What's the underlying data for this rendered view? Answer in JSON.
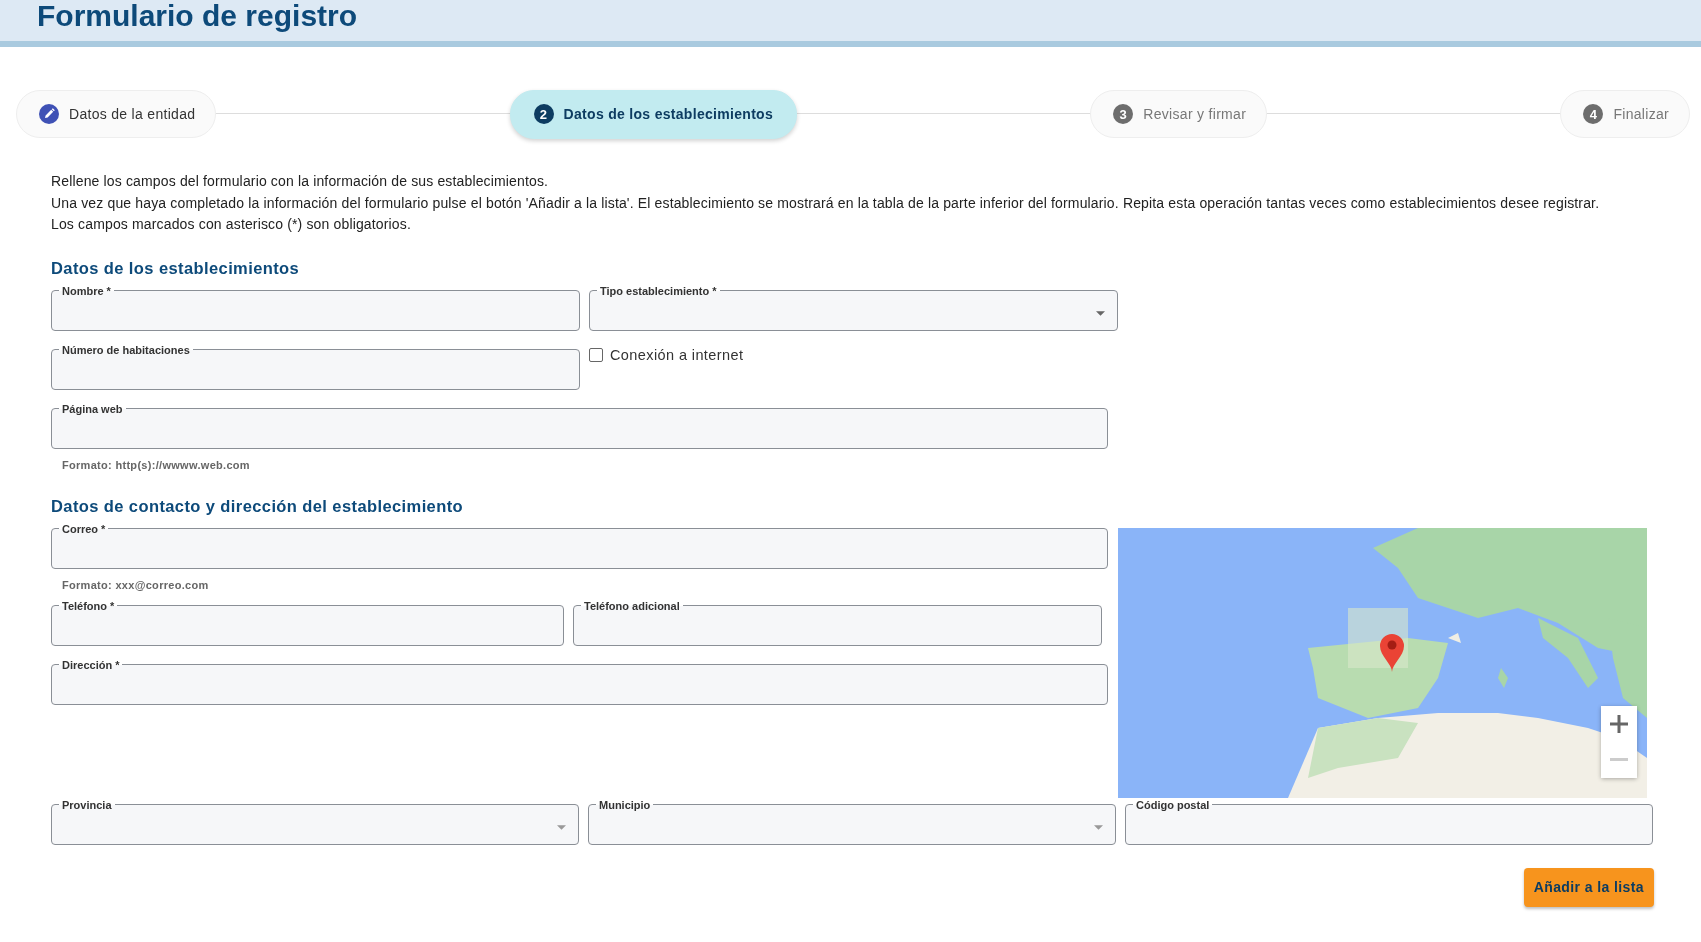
{
  "page": {
    "title": "Formulario de registro"
  },
  "steps": [
    {
      "label": "Datos de la entidad",
      "kind": "done",
      "selected": false
    },
    {
      "number": "2",
      "label": "Datos de los establecimientos",
      "kind": "current",
      "selected": true
    },
    {
      "number": "3",
      "label": "Revisar y firmar",
      "kind": "todo",
      "selected": false
    },
    {
      "number": "4",
      "label": "Finalizar",
      "kind": "todo",
      "selected": false
    }
  ],
  "intro": [
    "Rellene los campos del formulario con la información de sus establecimientos.",
    "Una vez que haya completado la información del formulario pulse el botón 'Añadir a la lista'. El establecimiento se mostrará en la tabla de la parte inferior del formulario. Repita esta operación tantas veces como establecimientos desee registrar.",
    "Los campos marcados con asterisco (*) son obligatorios."
  ],
  "establishment": {
    "title": "Datos de los establecimientos",
    "nombre": {
      "label": "Nombre *"
    },
    "tipo": {
      "label": "Tipo establecimiento *"
    },
    "habitaciones": {
      "label": "Número de habitaciones"
    },
    "internet": {
      "label": "Conexión a internet",
      "checked": false
    },
    "web": {
      "label": "Página web",
      "hint": "Formato: http(s)://wwww.web.com"
    }
  },
  "contact": {
    "title": "Datos de contacto y dirección del establecimiento",
    "correo": {
      "label": "Correo *",
      "hint": "Formato: xxx@correo.com"
    },
    "telefono": {
      "label": "Teléfono *"
    },
    "telefono_adicional": {
      "label": "Teléfono adicional"
    },
    "direccion": {
      "label": "Dirección *"
    },
    "provincia": {
      "label": "Provincia"
    },
    "municipio": {
      "label": "Municipio"
    },
    "codigo_postal": {
      "label": "Código postal"
    }
  },
  "add_button": "Añadir a la lista"
}
